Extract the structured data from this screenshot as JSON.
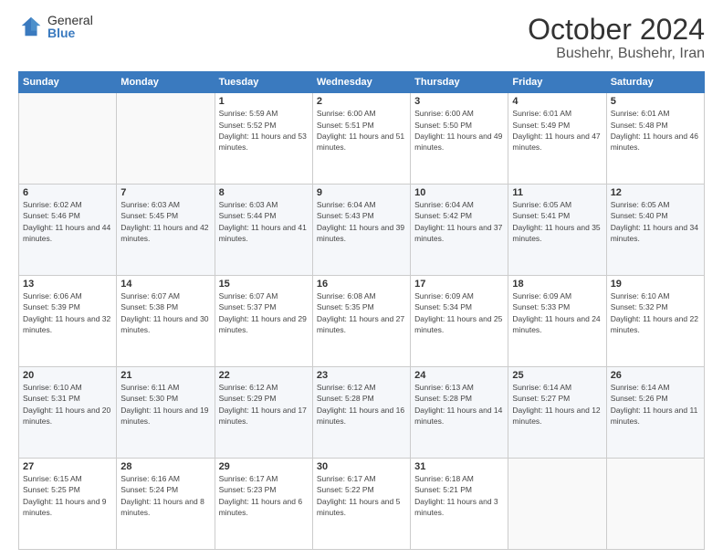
{
  "logo": {
    "general": "General",
    "blue": "Blue"
  },
  "header": {
    "month": "October 2024",
    "location": "Bushehr, Bushehr, Iran"
  },
  "weekdays": [
    "Sunday",
    "Monday",
    "Tuesday",
    "Wednesday",
    "Thursday",
    "Friday",
    "Saturday"
  ],
  "weeks": [
    [
      {
        "day": "",
        "sunrise": "",
        "sunset": "",
        "daylight": ""
      },
      {
        "day": "",
        "sunrise": "",
        "sunset": "",
        "daylight": ""
      },
      {
        "day": "1",
        "sunrise": "Sunrise: 5:59 AM",
        "sunset": "Sunset: 5:52 PM",
        "daylight": "Daylight: 11 hours and 53 minutes."
      },
      {
        "day": "2",
        "sunrise": "Sunrise: 6:00 AM",
        "sunset": "Sunset: 5:51 PM",
        "daylight": "Daylight: 11 hours and 51 minutes."
      },
      {
        "day": "3",
        "sunrise": "Sunrise: 6:00 AM",
        "sunset": "Sunset: 5:50 PM",
        "daylight": "Daylight: 11 hours and 49 minutes."
      },
      {
        "day": "4",
        "sunrise": "Sunrise: 6:01 AM",
        "sunset": "Sunset: 5:49 PM",
        "daylight": "Daylight: 11 hours and 47 minutes."
      },
      {
        "day": "5",
        "sunrise": "Sunrise: 6:01 AM",
        "sunset": "Sunset: 5:48 PM",
        "daylight": "Daylight: 11 hours and 46 minutes."
      }
    ],
    [
      {
        "day": "6",
        "sunrise": "Sunrise: 6:02 AM",
        "sunset": "Sunset: 5:46 PM",
        "daylight": "Daylight: 11 hours and 44 minutes."
      },
      {
        "day": "7",
        "sunrise": "Sunrise: 6:03 AM",
        "sunset": "Sunset: 5:45 PM",
        "daylight": "Daylight: 11 hours and 42 minutes."
      },
      {
        "day": "8",
        "sunrise": "Sunrise: 6:03 AM",
        "sunset": "Sunset: 5:44 PM",
        "daylight": "Daylight: 11 hours and 41 minutes."
      },
      {
        "day": "9",
        "sunrise": "Sunrise: 6:04 AM",
        "sunset": "Sunset: 5:43 PM",
        "daylight": "Daylight: 11 hours and 39 minutes."
      },
      {
        "day": "10",
        "sunrise": "Sunrise: 6:04 AM",
        "sunset": "Sunset: 5:42 PM",
        "daylight": "Daylight: 11 hours and 37 minutes."
      },
      {
        "day": "11",
        "sunrise": "Sunrise: 6:05 AM",
        "sunset": "Sunset: 5:41 PM",
        "daylight": "Daylight: 11 hours and 35 minutes."
      },
      {
        "day": "12",
        "sunrise": "Sunrise: 6:05 AM",
        "sunset": "Sunset: 5:40 PM",
        "daylight": "Daylight: 11 hours and 34 minutes."
      }
    ],
    [
      {
        "day": "13",
        "sunrise": "Sunrise: 6:06 AM",
        "sunset": "Sunset: 5:39 PM",
        "daylight": "Daylight: 11 hours and 32 minutes."
      },
      {
        "day": "14",
        "sunrise": "Sunrise: 6:07 AM",
        "sunset": "Sunset: 5:38 PM",
        "daylight": "Daylight: 11 hours and 30 minutes."
      },
      {
        "day": "15",
        "sunrise": "Sunrise: 6:07 AM",
        "sunset": "Sunset: 5:37 PM",
        "daylight": "Daylight: 11 hours and 29 minutes."
      },
      {
        "day": "16",
        "sunrise": "Sunrise: 6:08 AM",
        "sunset": "Sunset: 5:35 PM",
        "daylight": "Daylight: 11 hours and 27 minutes."
      },
      {
        "day": "17",
        "sunrise": "Sunrise: 6:09 AM",
        "sunset": "Sunset: 5:34 PM",
        "daylight": "Daylight: 11 hours and 25 minutes."
      },
      {
        "day": "18",
        "sunrise": "Sunrise: 6:09 AM",
        "sunset": "Sunset: 5:33 PM",
        "daylight": "Daylight: 11 hours and 24 minutes."
      },
      {
        "day": "19",
        "sunrise": "Sunrise: 6:10 AM",
        "sunset": "Sunset: 5:32 PM",
        "daylight": "Daylight: 11 hours and 22 minutes."
      }
    ],
    [
      {
        "day": "20",
        "sunrise": "Sunrise: 6:10 AM",
        "sunset": "Sunset: 5:31 PM",
        "daylight": "Daylight: 11 hours and 20 minutes."
      },
      {
        "day": "21",
        "sunrise": "Sunrise: 6:11 AM",
        "sunset": "Sunset: 5:30 PM",
        "daylight": "Daylight: 11 hours and 19 minutes."
      },
      {
        "day": "22",
        "sunrise": "Sunrise: 6:12 AM",
        "sunset": "Sunset: 5:29 PM",
        "daylight": "Daylight: 11 hours and 17 minutes."
      },
      {
        "day": "23",
        "sunrise": "Sunrise: 6:12 AM",
        "sunset": "Sunset: 5:28 PM",
        "daylight": "Daylight: 11 hours and 16 minutes."
      },
      {
        "day": "24",
        "sunrise": "Sunrise: 6:13 AM",
        "sunset": "Sunset: 5:28 PM",
        "daylight": "Daylight: 11 hours and 14 minutes."
      },
      {
        "day": "25",
        "sunrise": "Sunrise: 6:14 AM",
        "sunset": "Sunset: 5:27 PM",
        "daylight": "Daylight: 11 hours and 12 minutes."
      },
      {
        "day": "26",
        "sunrise": "Sunrise: 6:14 AM",
        "sunset": "Sunset: 5:26 PM",
        "daylight": "Daylight: 11 hours and 11 minutes."
      }
    ],
    [
      {
        "day": "27",
        "sunrise": "Sunrise: 6:15 AM",
        "sunset": "Sunset: 5:25 PM",
        "daylight": "Daylight: 11 hours and 9 minutes."
      },
      {
        "day": "28",
        "sunrise": "Sunrise: 6:16 AM",
        "sunset": "Sunset: 5:24 PM",
        "daylight": "Daylight: 11 hours and 8 minutes."
      },
      {
        "day": "29",
        "sunrise": "Sunrise: 6:17 AM",
        "sunset": "Sunset: 5:23 PM",
        "daylight": "Daylight: 11 hours and 6 minutes."
      },
      {
        "day": "30",
        "sunrise": "Sunrise: 6:17 AM",
        "sunset": "Sunset: 5:22 PM",
        "daylight": "Daylight: 11 hours and 5 minutes."
      },
      {
        "day": "31",
        "sunrise": "Sunrise: 6:18 AM",
        "sunset": "Sunset: 5:21 PM",
        "daylight": "Daylight: 11 hours and 3 minutes."
      },
      {
        "day": "",
        "sunrise": "",
        "sunset": "",
        "daylight": ""
      },
      {
        "day": "",
        "sunrise": "",
        "sunset": "",
        "daylight": ""
      }
    ]
  ]
}
